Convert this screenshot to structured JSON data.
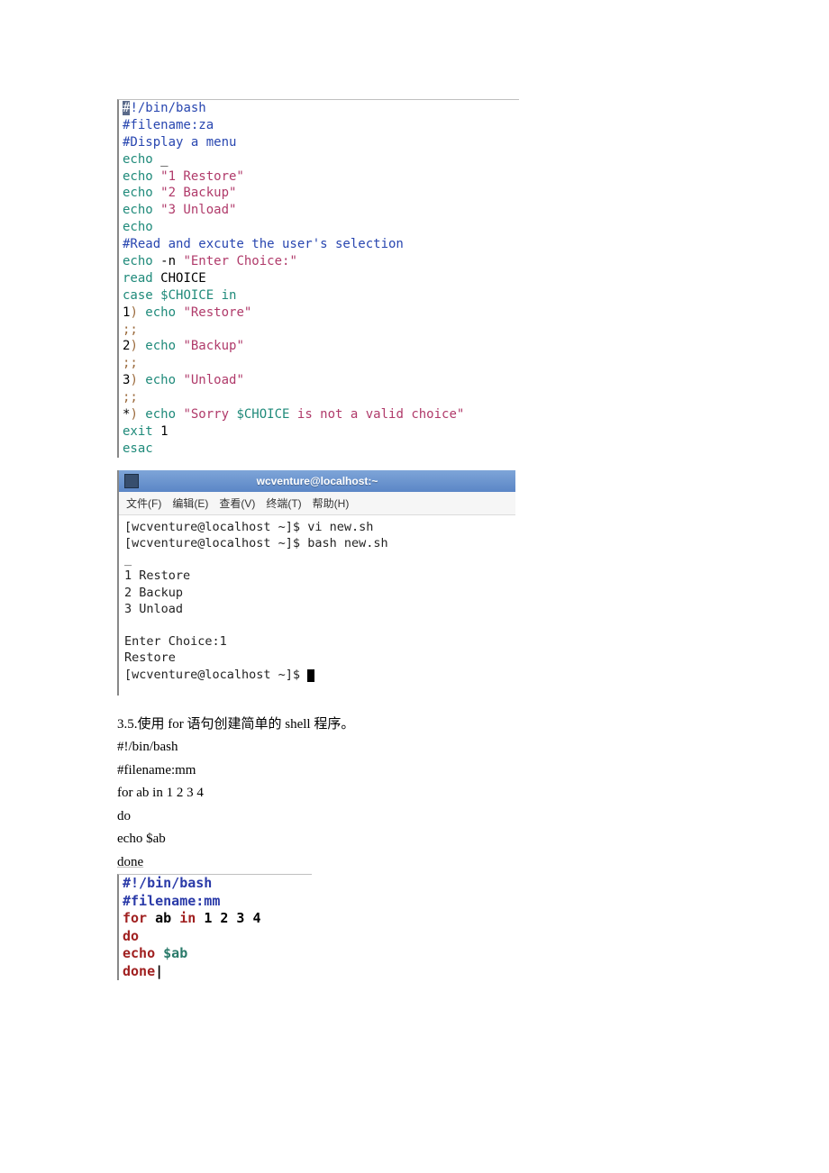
{
  "code1": {
    "l01a": "#",
    "l01b": "!/bin/bash",
    "l02": "#filename:za",
    "l03": "#Display a menu",
    "l04": "echo",
    "l04b": "_",
    "l05a": "echo",
    "l05b": " \"1 Restore\"",
    "l06a": "echo",
    "l06b": " \"2 Backup\"",
    "l07a": "echo",
    "l07b": " \"3 Unload\"",
    "l08": "echo",
    "l09": "#Read and excute the user's selection",
    "l10a": "echo",
    "l10b": " -n ",
    "l10c": "\"Enter Choice:\"",
    "l11a": "read ",
    "l11b": "CHOICE",
    "l12a": "case ",
    "l12b": "$CHOICE ",
    "l12c": "in",
    "l13a": "1",
    "l13b": ") ",
    "l13c": "echo",
    "l13d": " \"Restore\"",
    "l14": ";;",
    "l15a": "2",
    "l15b": ") ",
    "l15c": "echo",
    "l15d": " \"Backup\"",
    "l16": ";;",
    "l17a": "3",
    "l17b": ") ",
    "l17c": "echo",
    "l17d": " \"Unload\"",
    "l18": ";;",
    "l19a": "*",
    "l19b": ") ",
    "l19c": "echo",
    "l19d": " \"Sorry ",
    "l19e": "$CHOICE",
    "l19f": " is not a valid choice\"",
    "l20a": "exit ",
    "l20b": "1",
    "l21": "esac"
  },
  "term": {
    "title": "wcventure@localhost:~",
    "menu": {
      "file": "文件(F)",
      "edit": "编辑(E)",
      "view": "查看(V)",
      "terminal": "终端(T)",
      "help": "帮助(H)"
    },
    "body": "[wcventure@localhost ~]$ vi new.sh\n[wcventure@localhost ~]$ bash new.sh\n_\n1 Restore\n2 Backup\n3 Unload\n\nEnter Choice:1\nRestore\n[wcventure@localhost ~]$ "
  },
  "doc": {
    "h": "3.5.使用 for 语句创建简单的 shell 程序。",
    "l1": "#!/bin/bash",
    "l2": "#filename:mm",
    "l3": "for ab in 1 2 3 4",
    "l4": "do",
    "l5": "echo $ab",
    "l6": "done"
  },
  "code2": {
    "l1": "#!/bin/bash",
    "l2": "#filename:mm",
    "l3a": "for ",
    "l3b": "ab ",
    "l3c": "in ",
    "l3d": "1 2 3 4",
    "l4": "do",
    "l5a": "echo ",
    "l5b": "$ab",
    "l6": "done",
    "cursor": "|"
  }
}
